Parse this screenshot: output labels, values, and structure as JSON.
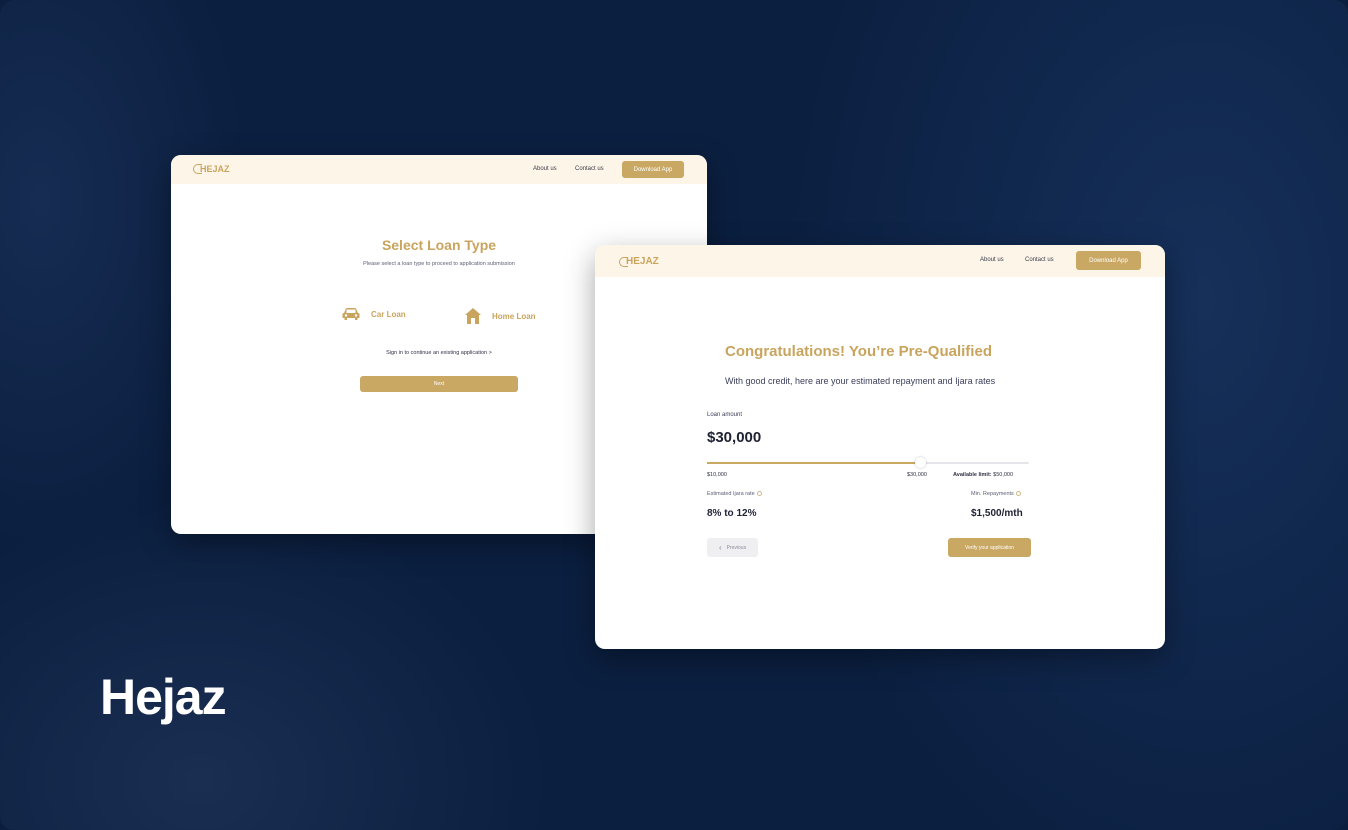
{
  "brand": {
    "name": "Hejaz"
  },
  "colors": {
    "accent": "#c9a864",
    "background": "#0b1f40",
    "nav_bg": "#fdf6e8"
  },
  "window_select_loan": {
    "nav": {
      "logo": "HEJAZ",
      "about": "About us",
      "contact": "Contact us",
      "download": "Download App"
    },
    "title": "Select Loan Type",
    "subtitle": "Please select a loan type to proceed to application submission",
    "options": [
      {
        "label": "Car Loan",
        "icon": "car-icon"
      },
      {
        "label": "Home Loan",
        "icon": "home-icon"
      }
    ],
    "signin": "Sign in to continue an existing application >",
    "next": "Next"
  },
  "window_prequalified": {
    "nav": {
      "logo": "HEJAZ",
      "about": "About us",
      "contact": "Contact us",
      "download": "Download App"
    },
    "title": "Congratulations! You’re Pre-Qualified",
    "subtitle": "With good credit, here are your estimated repayment and Ijara rates",
    "loan_label": "Loan amount",
    "loan_amount": "$30,000",
    "slider": {
      "min_label": "$10,000",
      "current_label": "$30,000",
      "available_prefix": "Available limit:",
      "available_value": "$50,000",
      "fill_fraction": 0.66
    },
    "rate_label": "Estimated Ijara rate",
    "rate_value": "8% to 12%",
    "repayment_label": "Min. Repayments",
    "repayment_value": "$1,500/mth",
    "previous": "Previous",
    "verify": "Verify your application"
  }
}
